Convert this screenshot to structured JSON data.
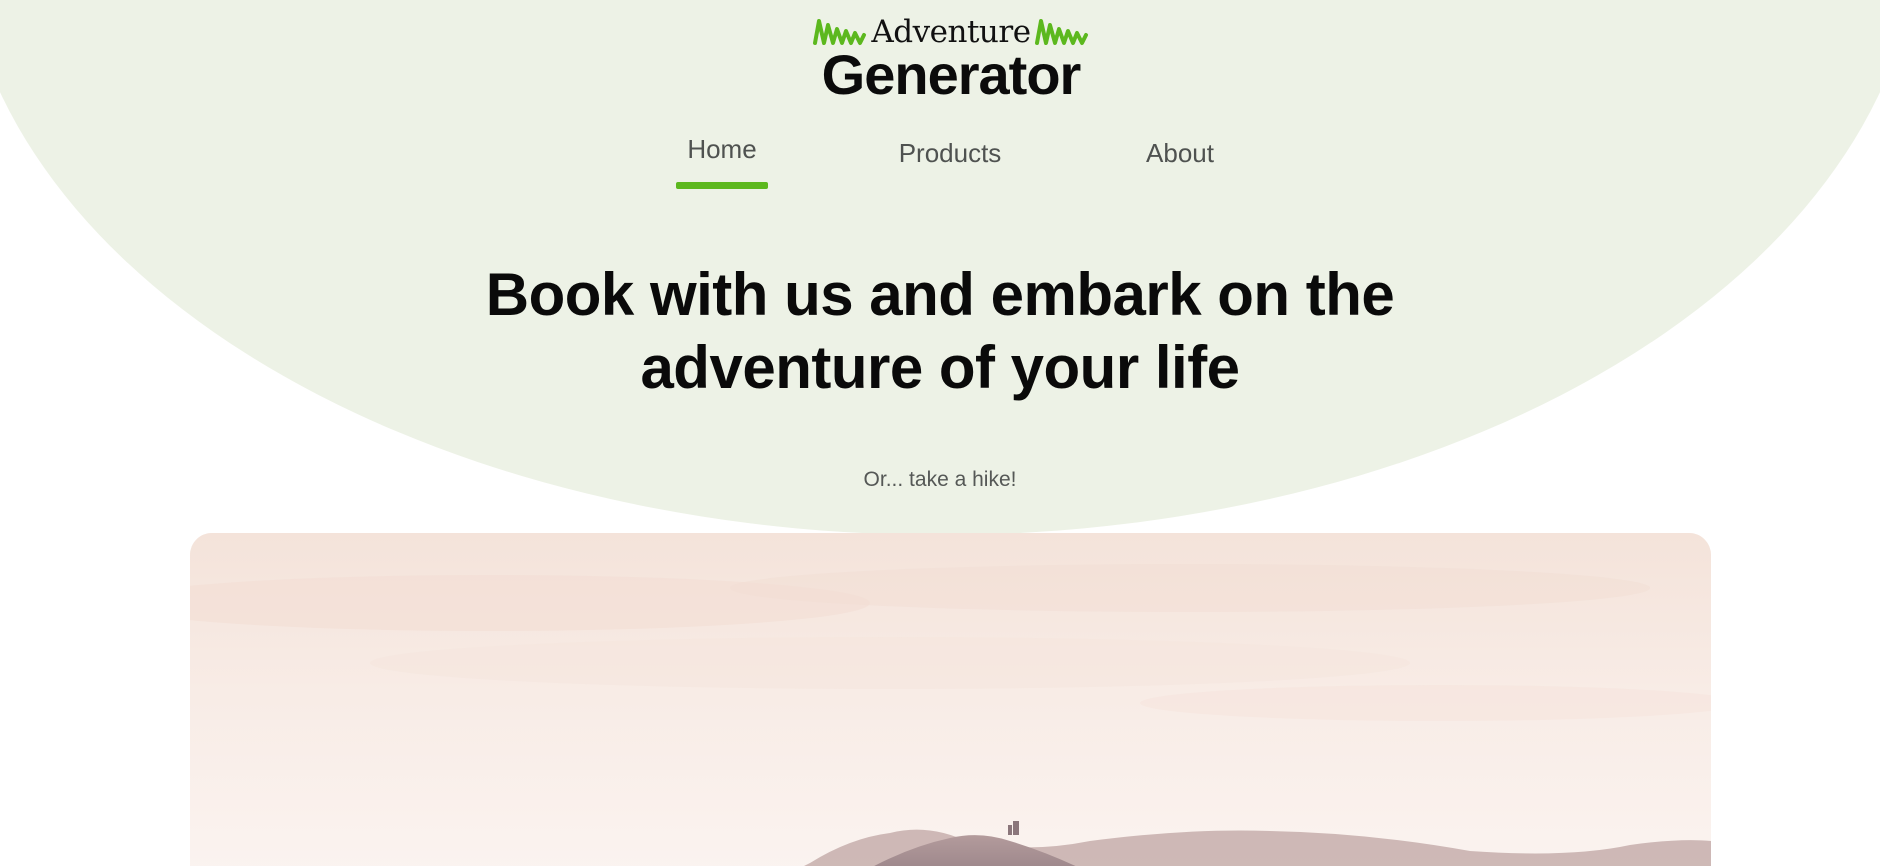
{
  "brand": {
    "line1": "Adventure",
    "line2": "Generator",
    "accent_color": "#5cb81e"
  },
  "nav": {
    "items": [
      {
        "label": "Home",
        "active": true
      },
      {
        "label": "Products",
        "active": false
      },
      {
        "label": "About",
        "active": false
      }
    ]
  },
  "hero": {
    "headline": "Book with us and embark on the adventure of your life",
    "subline": "Or... take a hike!",
    "background_color": "#edf2e6"
  },
  "icons": {
    "logo_left": "grass-zigzag-icon",
    "logo_right": "grass-zigzag-icon"
  }
}
